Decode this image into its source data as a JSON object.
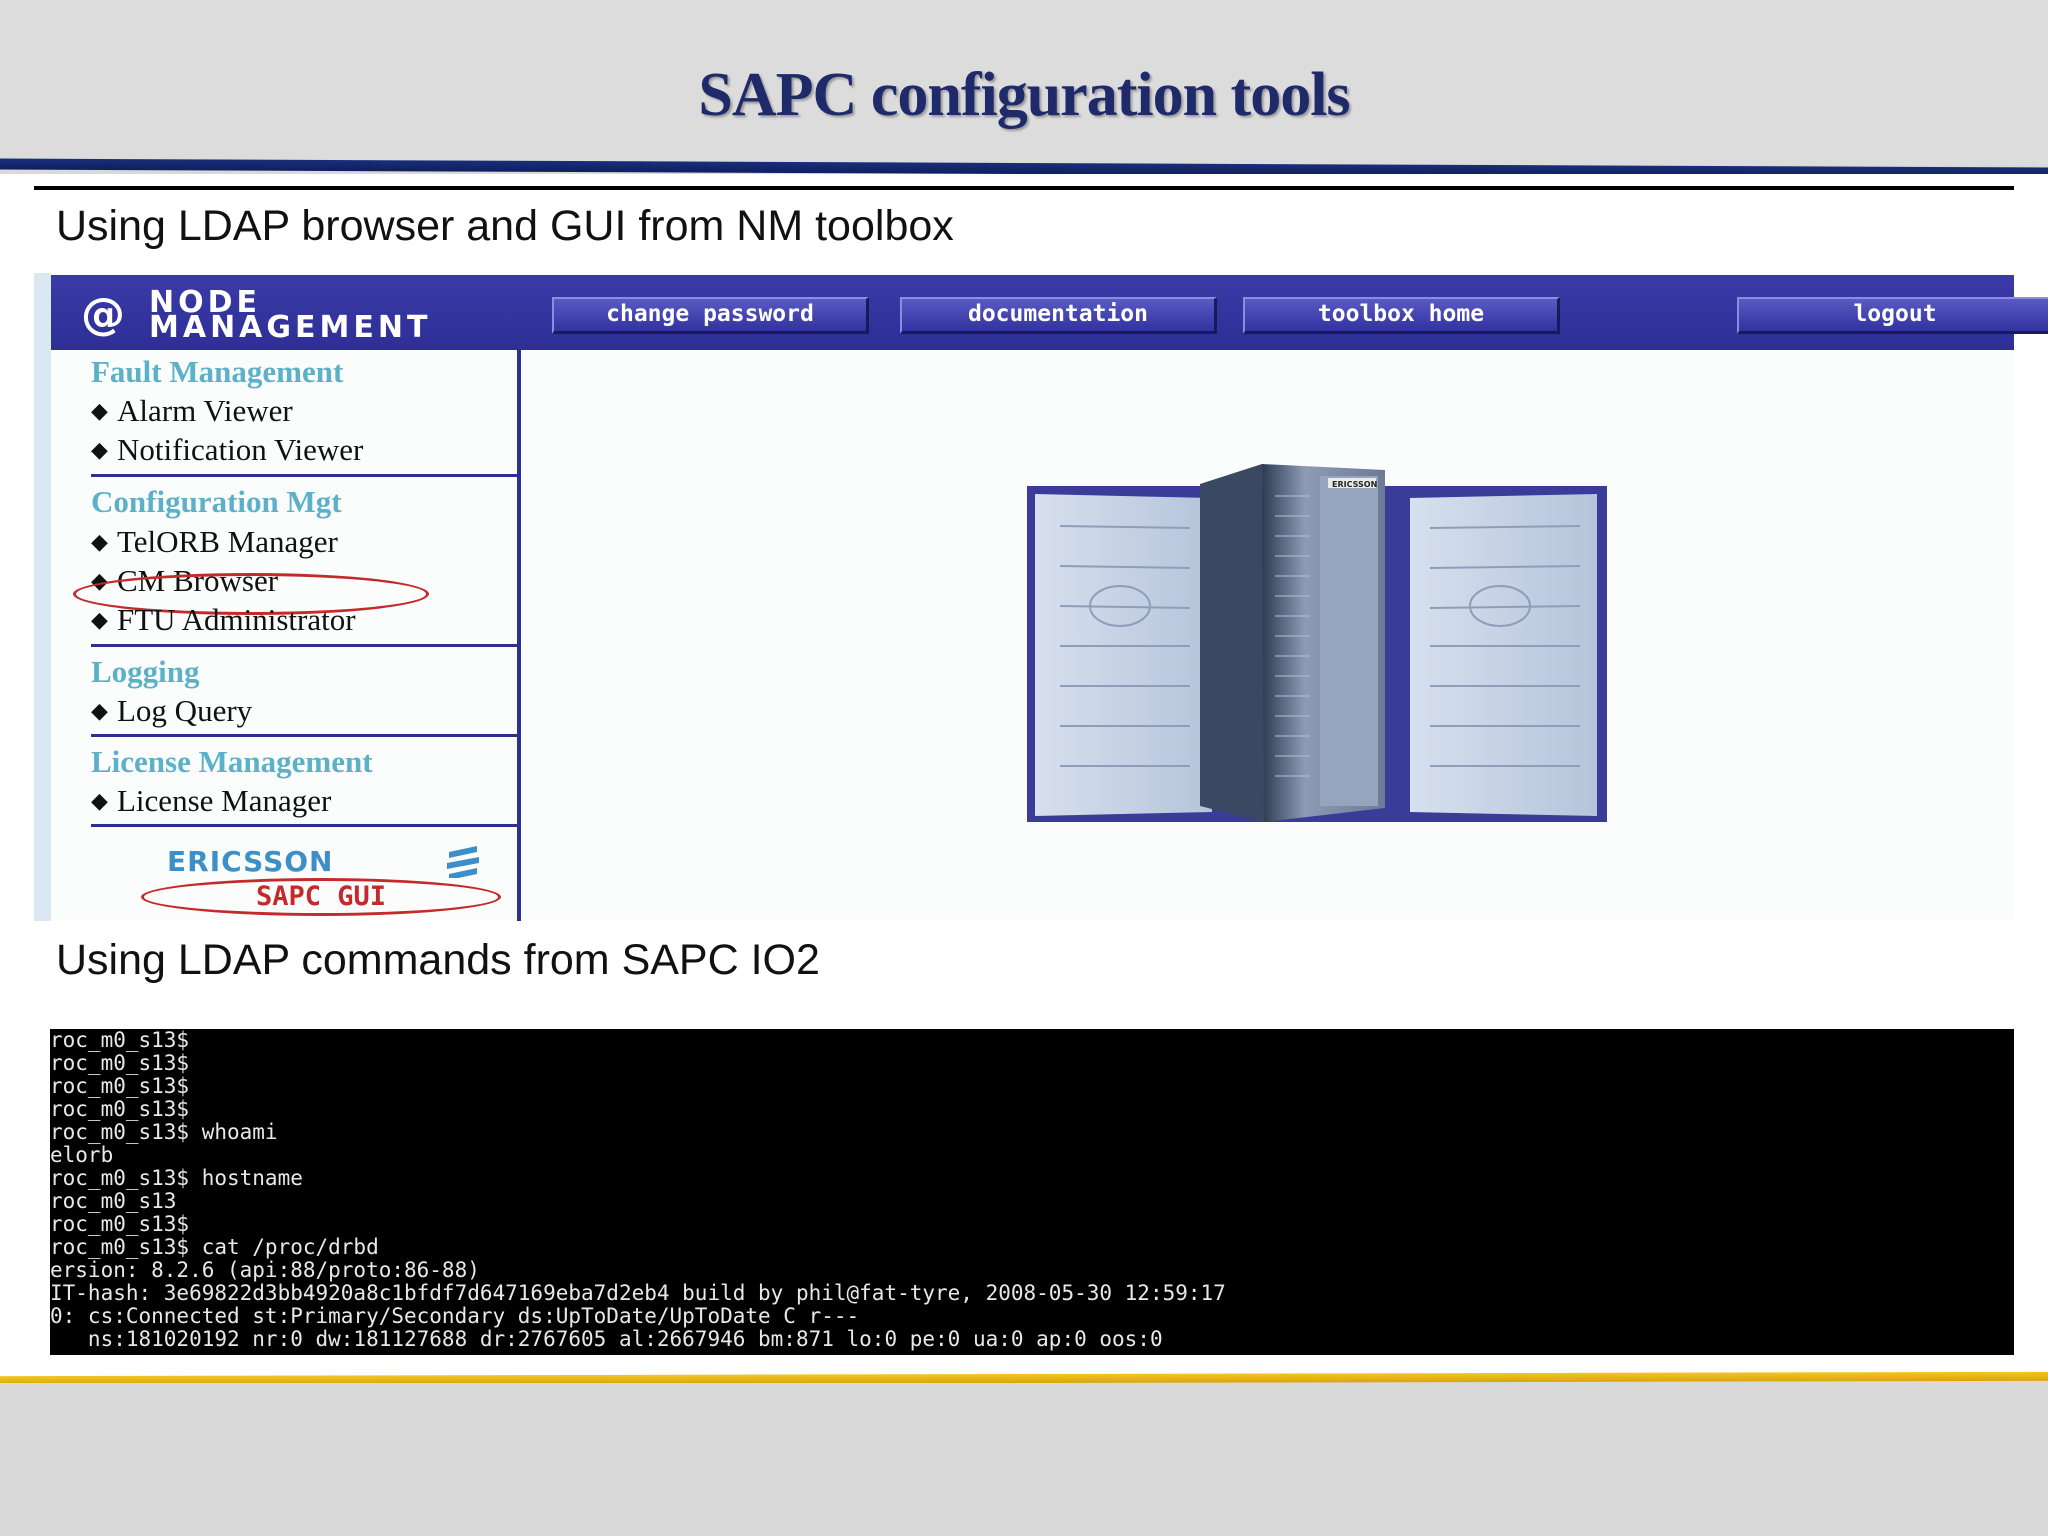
{
  "slide": {
    "title": "SAPC configuration tools",
    "subheading_1": "Using LDAP browser and GUI from NM toolbox",
    "subheading_2": "Using LDAP commands from SAPC IO2"
  },
  "nm_toolbox": {
    "logo": {
      "at": "@",
      "line1": "NODE",
      "line2": "MANAGEMENT"
    },
    "buttons": {
      "change_password": "change password",
      "documentation": "documentation",
      "toolbox_home": "toolbox home",
      "logout": "logout"
    },
    "sidebar": {
      "fault": {
        "title": "Fault Management",
        "items": [
          "Alarm Viewer",
          "Notification Viewer"
        ]
      },
      "config": {
        "title": "Configuration Mgt",
        "items": [
          "TelORB Manager",
          "CM Browser",
          "FTU Administrator"
        ]
      },
      "logging": {
        "title": "Logging",
        "items": [
          "Log Query"
        ]
      },
      "license": {
        "title": "License Management",
        "items": [
          "License Manager"
        ]
      }
    },
    "brand": "ERICSSON",
    "sapc_gui": "SAPC GUI",
    "cabinet_label": "ERICSSON",
    "colors": {
      "topbar": "#2e2e96",
      "section_title": "#5cb0c8",
      "highlight_oval": "#c42a2a"
    }
  },
  "terminal": {
    "lines": [
      "roc_m0_s13$",
      "roc_m0_s13$",
      "roc_m0_s13$",
      "roc_m0_s13$",
      "roc_m0_s13$ whoami",
      "elorb",
      "roc_m0_s13$ hostname",
      "roc_m0_s13",
      "roc_m0_s13$",
      "roc_m0_s13$ cat /proc/drbd",
      "ersion: 8.2.6 (api:88/proto:86-88)",
      "IT-hash: 3e69822d3bb4920a8c1bfdf7d647169eba7d2eb4 build by phil@fat-tyre, 2008-05-30 12:59:17",
      "0: cs:Connected st:Primary/Secondary ds:UpToDate/UpToDate C r---",
      "   ns:181020192 nr:0 dw:181127688 dr:2767605 al:2667946 bm:871 lo:0 pe:0 ua:0 ap:0 oos:0"
    ]
  }
}
